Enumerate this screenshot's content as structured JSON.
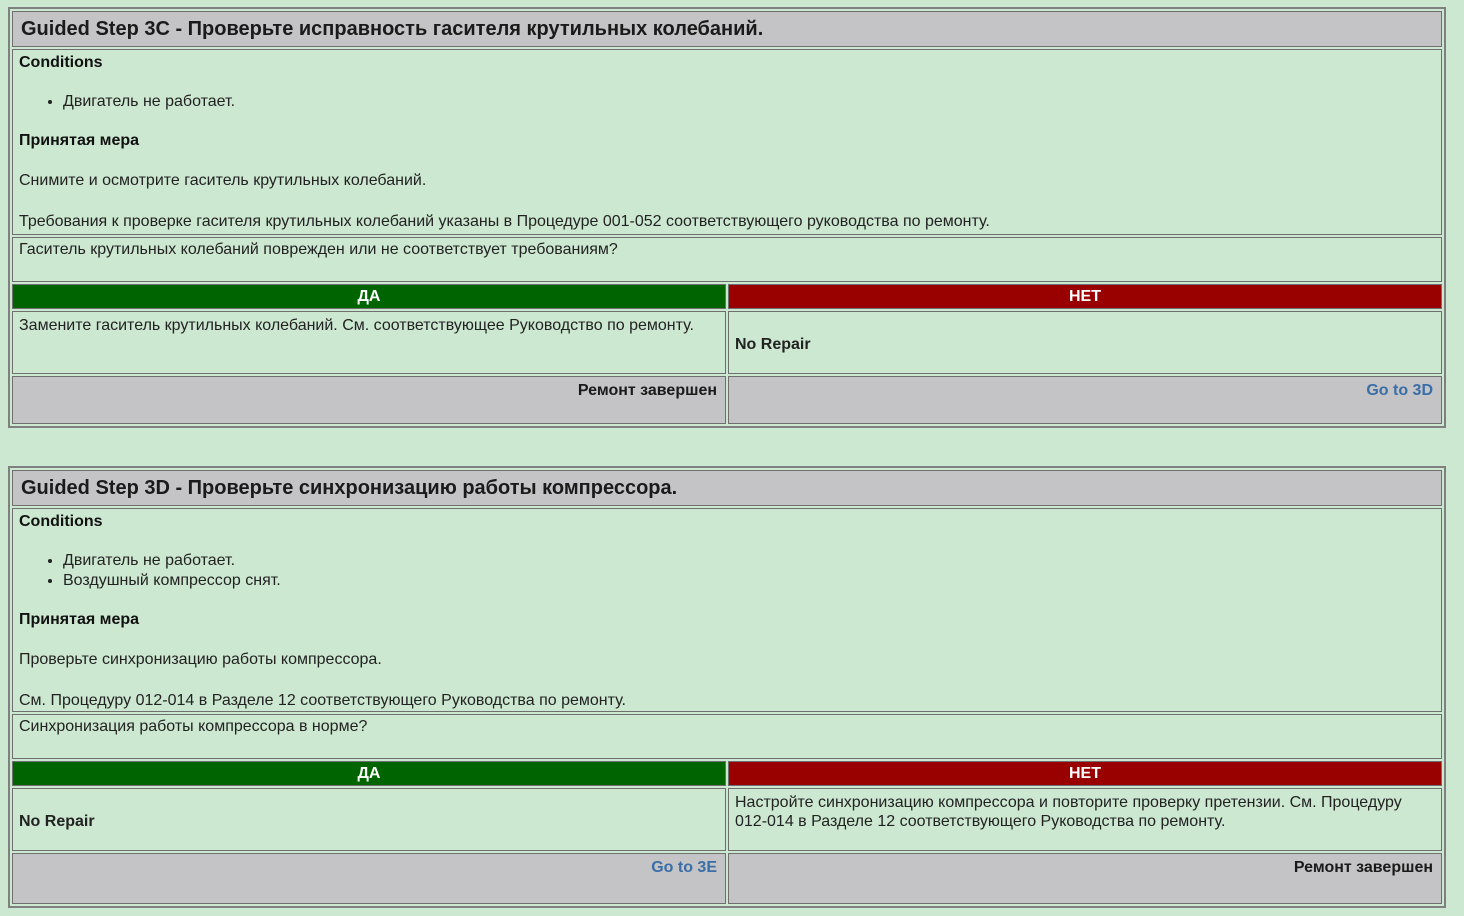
{
  "steps": [
    {
      "title": "Guided Step 3C - Проверьте исправность гасителя крутильных колебаний.",
      "conditions_label": "Conditions",
      "conditions": [
        "Двигатель не работает."
      ],
      "action_label": "Принятая мера",
      "action_paragraphs": [
        "Снимите и осмотрите гаситель крутильных колебаний.",
        "Требования к проверке гасителя крутильных колебаний указаны в Процедуре 001-052 соответствующего руководства по ремонту."
      ],
      "question": "Гаситель крутильных колебаний поврежден или не соответствует требованиям?",
      "yes_label": "ДА",
      "no_label": "НЕТ",
      "yes_answer": "Замените гаситель крутильных колебаний. См. соответствующее Руководство по ремонту.",
      "no_answer": "No Repair",
      "yes_footer": "Ремонт завершен",
      "no_footer": "Go to 3D"
    },
    {
      "title": "Guided Step 3D - Проверьте синхронизацию работы компрессора.",
      "conditions_label": "Conditions",
      "conditions": [
        "Двигатель не работает.",
        "Воздушный компрессор снят."
      ],
      "action_label": "Принятая мера",
      "action_paragraphs": [
        "Проверьте синхронизацию работы компрессора.",
        "См. Процедуру 012-014 в Разделе 12 соответствующего Руководства по ремонту."
      ],
      "question": "Синхронизация работы компрессора в норме?",
      "yes_label": "ДА",
      "no_label": "НЕТ",
      "yes_answer": "No Repair",
      "no_answer": "Настройте синхронизацию компрессора и повторите проверку претензии. См. Процедуру 012-014 в Разделе 12 соответствующего Руководства по ремонту.",
      "yes_footer": "Go to 3E",
      "no_footer": "Ремонт завершен"
    }
  ],
  "colors": {
    "background": "#cde8d1",
    "header_gray": "#c4c4c6",
    "yes_green": "#006400",
    "no_red": "#990000",
    "link_blue": "#3a6ea8"
  }
}
